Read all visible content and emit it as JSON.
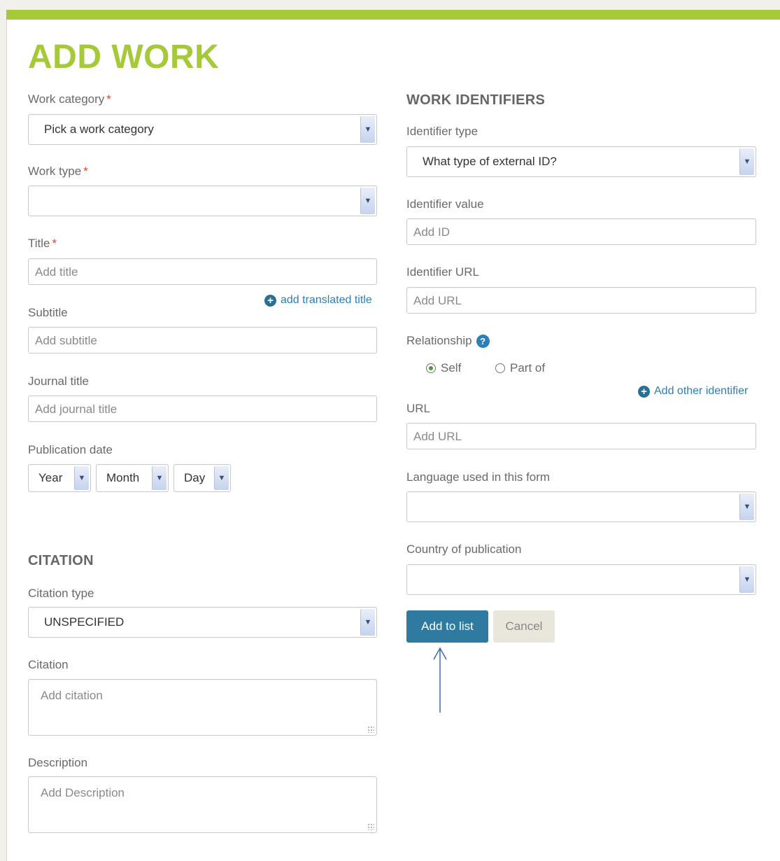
{
  "page": {
    "title": "ADD WORK"
  },
  "left": {
    "work_category": {
      "label": "Work category",
      "required_mark": "*",
      "value": "Pick a work category"
    },
    "work_type": {
      "label": "Work type",
      "required_mark": "*",
      "value": ""
    },
    "title": {
      "label": "Title",
      "required_mark": "*",
      "placeholder": "Add title"
    },
    "add_translated_title": "add translated title",
    "subtitle": {
      "label": "Subtitle",
      "placeholder": "Add subtitle"
    },
    "journal_title": {
      "label": "Journal title",
      "placeholder": "Add journal title"
    },
    "publication_date": {
      "label": "Publication date",
      "year": "Year",
      "month": "Month",
      "day": "Day"
    }
  },
  "citation": {
    "heading": "CITATION",
    "citation_type": {
      "label": "Citation type",
      "value": "UNSPECIFIED"
    },
    "citation": {
      "label": "Citation",
      "placeholder": "Add citation"
    },
    "description": {
      "label": "Description",
      "placeholder": "Add Description"
    }
  },
  "identifiers": {
    "heading": "WORK IDENTIFIERS",
    "identifier_type": {
      "label": "Identifier type",
      "value": "What type of external ID?"
    },
    "identifier_value": {
      "label": "Identifier value",
      "placeholder": "Add ID"
    },
    "identifier_url": {
      "label": "Identifier URL",
      "placeholder": "Add URL"
    },
    "relationship": {
      "label": "Relationship",
      "help_icon": "?",
      "self": "Self",
      "part_of": "Part of",
      "selected": "Self"
    },
    "add_other_identifier": "Add other identifier"
  },
  "right": {
    "url": {
      "label": "URL",
      "placeholder": "Add URL"
    },
    "language": {
      "label": "Language used in this form",
      "value": ""
    },
    "country": {
      "label": "Country of publication",
      "value": ""
    }
  },
  "buttons": {
    "add_to_list": "Add to list",
    "cancel": "Cancel"
  },
  "icons": {
    "plus": "plus-circle-icon",
    "help": "question-circle-icon",
    "dropdown": "chevron-down-icon",
    "annotation": "up-arrow-icon"
  },
  "colors": {
    "accent": "#a6c93a",
    "primary": "#2f7aa0",
    "link": "#2c7fb8",
    "required": "#d9442f",
    "annotation": "#3c6aa8"
  }
}
